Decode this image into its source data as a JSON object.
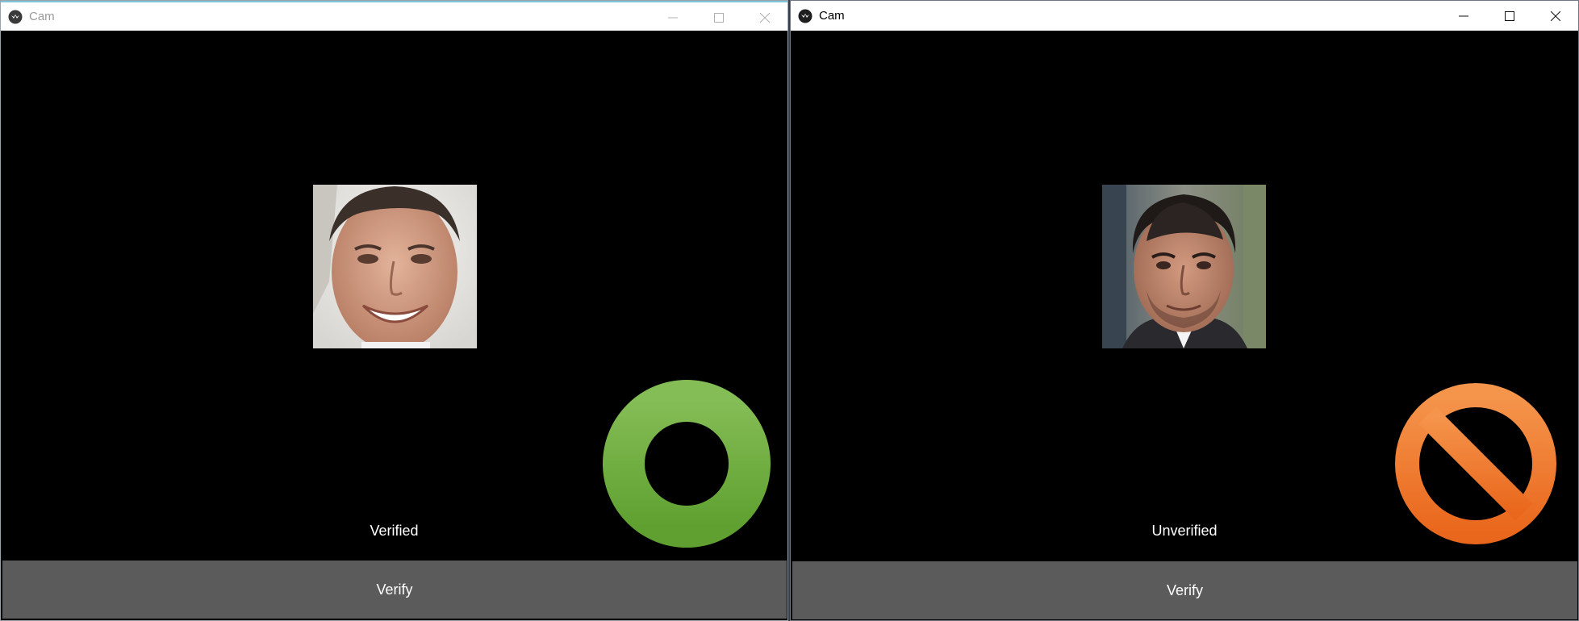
{
  "windows": [
    {
      "title": "Cam",
      "status_label": "Verified",
      "status_color": "#6aa93c",
      "button_label": "Verify",
      "state": "verified"
    },
    {
      "title": "Cam",
      "status_label": "Unverified",
      "status_color": "#f07a2a",
      "button_label": "Verify",
      "state": "unverified"
    }
  ],
  "icons": {
    "app": "kivy-logo-icon",
    "minimize": "minimize-icon",
    "maximize": "maximize-icon",
    "close": "close-icon",
    "verified": "ring-icon",
    "unverified": "prohibited-icon"
  },
  "colors": {
    "button_bg": "#5b5b5b",
    "content_bg": "#000000",
    "titlebar_bg": "#ffffff"
  }
}
